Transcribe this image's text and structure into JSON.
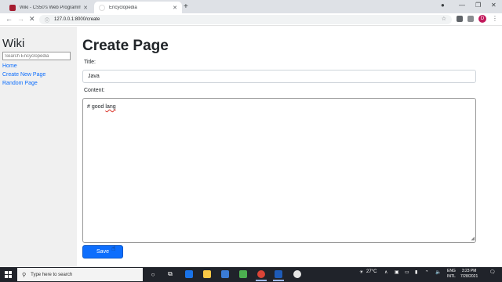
{
  "browser": {
    "tabs": [
      {
        "title": "Wiki - CS50's Web Programming",
        "active": false
      },
      {
        "title": "Encyclopedia",
        "active": true
      }
    ],
    "address": "127.0.0.1:8000/create",
    "profile_initial": "D"
  },
  "sidebar": {
    "brand": "Wiki",
    "search_placeholder": "Search Encyclopedia",
    "links": [
      "Home",
      "Create New Page",
      "Random Page"
    ]
  },
  "main": {
    "heading": "Create Page",
    "title_label": "Title:",
    "title_value": "Java",
    "content_label": "Content:",
    "content_hash": "#",
    "content_word1": "good",
    "content_word2": "lang",
    "save_label": "Save"
  },
  "taskbar": {
    "search_placeholder": "Type here to search",
    "weather": "27°C",
    "lang_line1": "ENG",
    "lang_line2": "INTL",
    "time": "3:23 PM",
    "date": "7/28/2021"
  },
  "colors": {
    "primary": "#0d6efd",
    "sidebar_bg": "#f0f0f0",
    "taskbar_bg": "#20232a"
  }
}
